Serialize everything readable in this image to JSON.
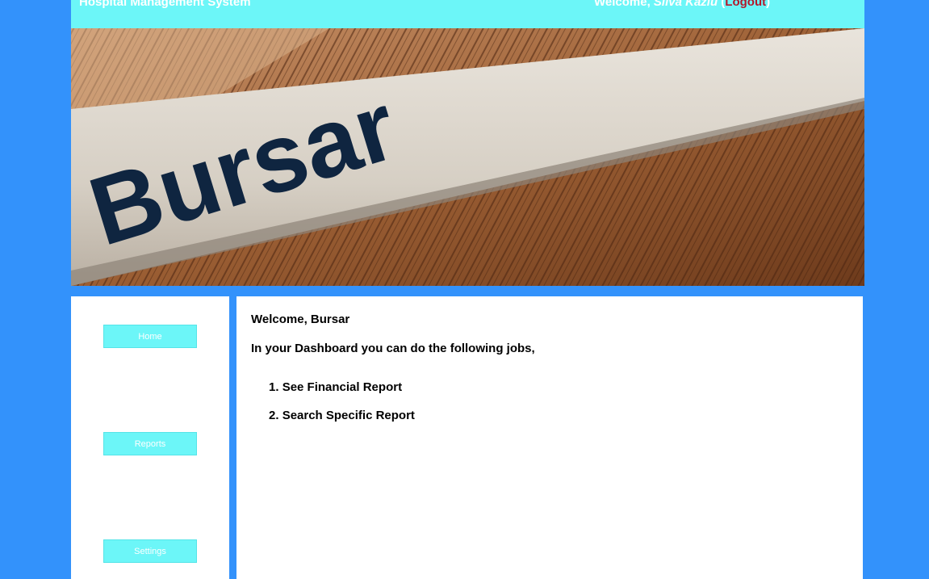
{
  "header": {
    "app_title": "Hospital Management System",
    "welcome_prefix": "Welcome, ",
    "user_name": "Silva Kaziu",
    "paren_open": " (",
    "logout_label": "Logout",
    "paren_close": ")"
  },
  "banner": {
    "sign_text": "Bursar"
  },
  "sidebar": {
    "items": [
      {
        "label": "Home"
      },
      {
        "label": "Reports"
      },
      {
        "label": "Settings"
      }
    ]
  },
  "main": {
    "greeting": "Welcome, Bursar",
    "intro": "In your Dashboard you can do the following jobs,",
    "jobs": [
      {
        "number": "1.",
        "label": "See Financial Report"
      },
      {
        "number": "2.",
        "label": "Search Specific Report"
      }
    ]
  },
  "colors": {
    "background": "#3392fb",
    "accent": "#6cf6f8",
    "logout": "#b3172b"
  }
}
